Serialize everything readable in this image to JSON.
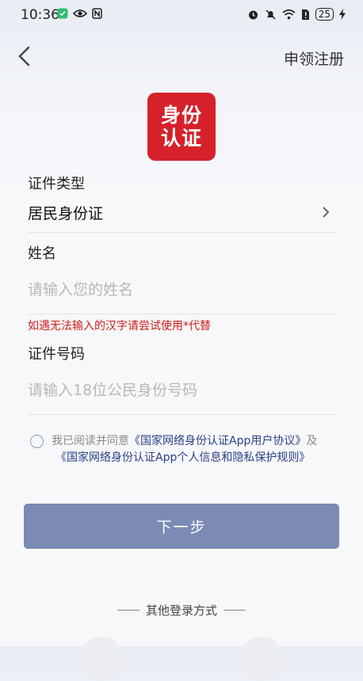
{
  "status_bar": {
    "time": "10:36",
    "battery": "25"
  },
  "header": {
    "register": "申领注册"
  },
  "logo": {
    "line1": "身份",
    "line2": "认证"
  },
  "form": {
    "id_type_label": "证件类型",
    "id_type_value": "居民身份证",
    "name_label": "姓名",
    "name_placeholder": "请输入您的姓名",
    "hint": "如遇无法输入的汉字请尝试使用*代替",
    "id_number_label": "证件号码",
    "id_number_placeholder": "请输入18位公民身份号码"
  },
  "agreement": {
    "prefix": "我已阅读并同意",
    "user_agreement": "《国家网络身份认证App用户协议》",
    "and": "及",
    "privacy_rules": "《国家网络身份认证App个人信息和隐私保护规则》"
  },
  "next_button": "下一步",
  "other_login": "其他登录方式"
}
